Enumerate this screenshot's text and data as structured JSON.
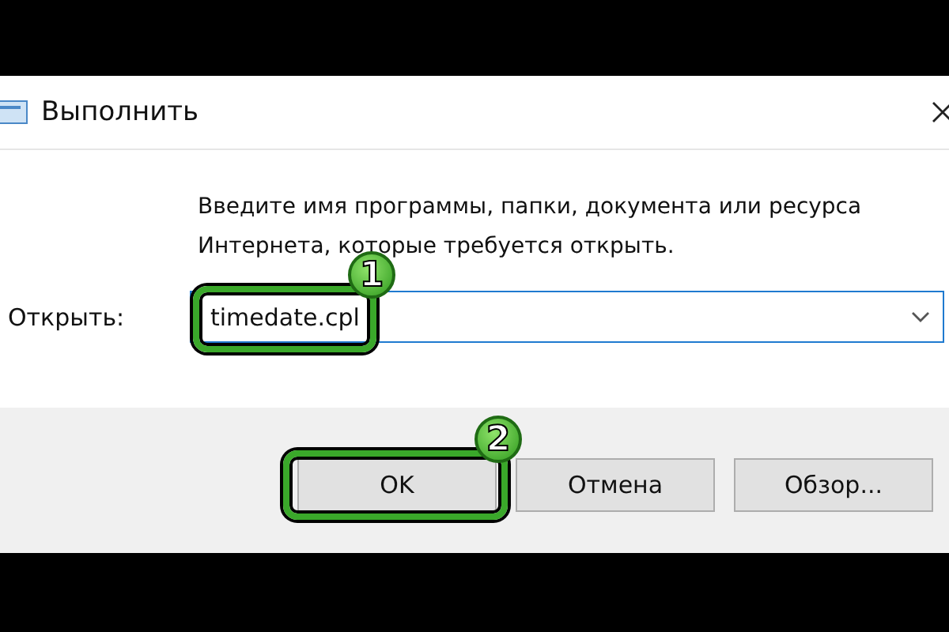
{
  "window": {
    "title": "Выполнить"
  },
  "prompt": "Введите имя программы, папки, документа или ресурса Интернета, которые требуется открыть.",
  "open_field": {
    "label": "Открыть:",
    "value": "timedate.cpl"
  },
  "buttons": [
    {
      "label": "OK",
      "highlight": "2"
    },
    {
      "label": "Отмена"
    },
    {
      "label": "Обзор..."
    }
  ],
  "field_highlight": "1"
}
